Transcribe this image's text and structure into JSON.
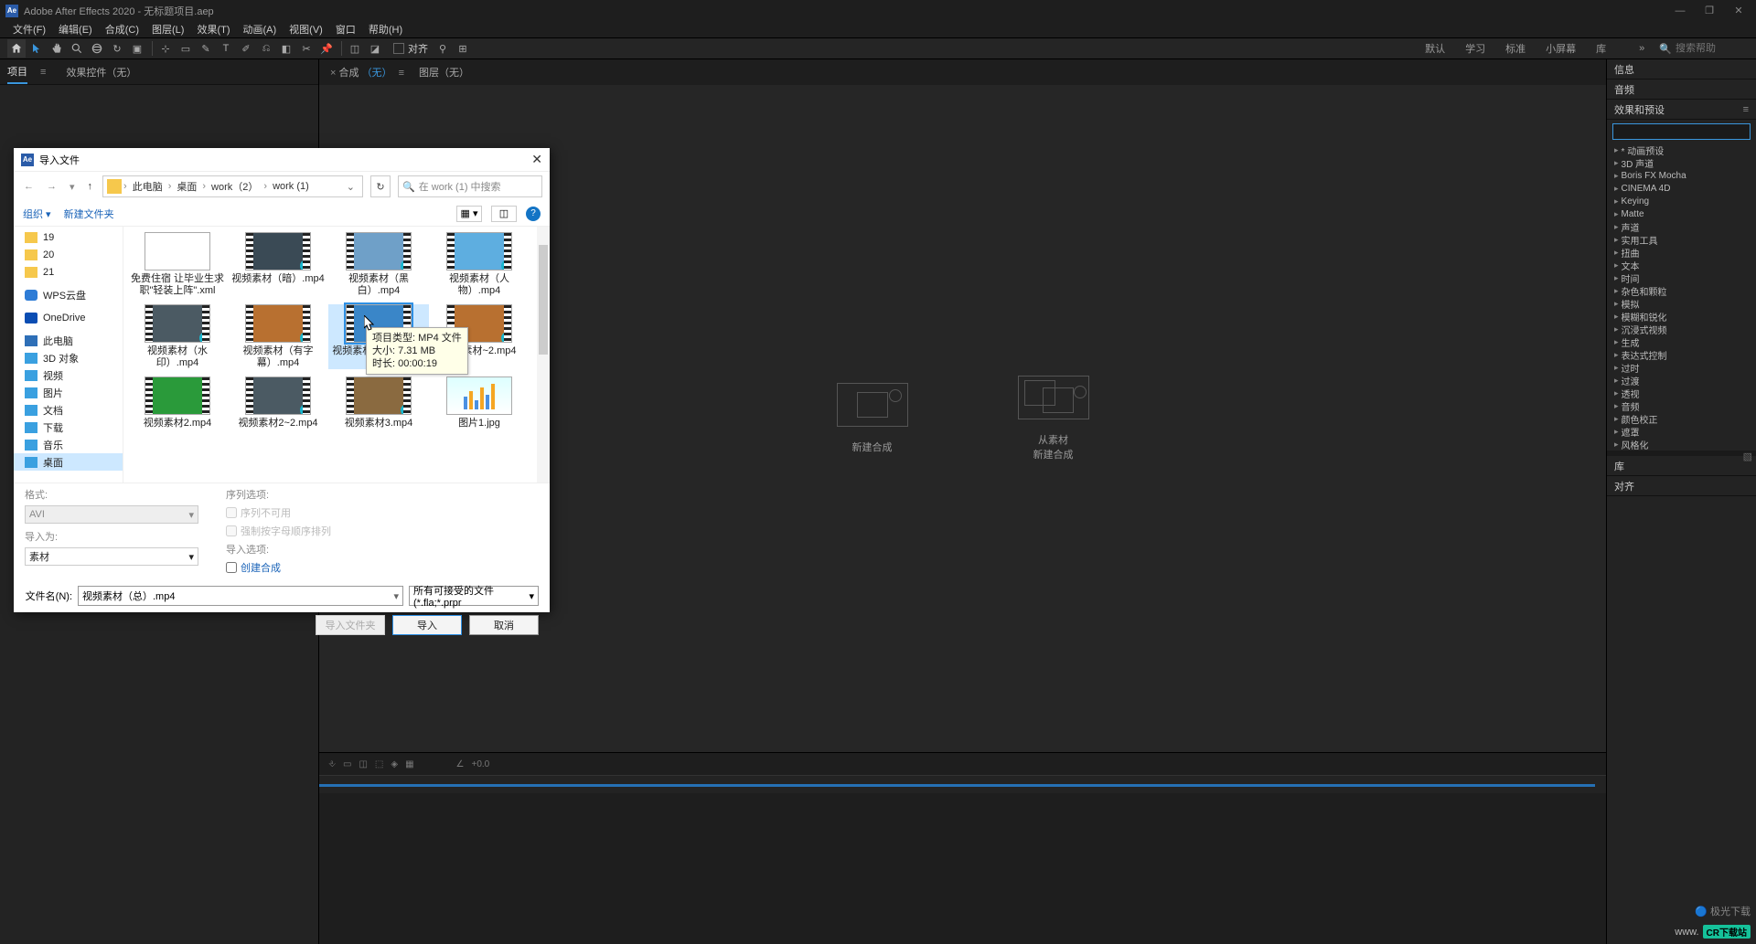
{
  "title": "Adobe After Effects 2020 - 无标题项目.aep",
  "menu": [
    "文件(F)",
    "编辑(E)",
    "合成(C)",
    "图层(L)",
    "效果(T)",
    "动画(A)",
    "视图(V)",
    "窗口",
    "帮助(H)"
  ],
  "toolbar": {
    "snap_label": "对齐"
  },
  "workspaces": [
    "默认",
    "学习",
    "标准",
    "小屏幕",
    "库"
  ],
  "search_help_placeholder": "搜索帮助",
  "left_panel": {
    "project": "项目",
    "menu_glyph": "≡",
    "effect_controls": "效果控件（无）"
  },
  "center": {
    "comp_tab_prefix": "合成",
    "comp_tab_accent": "（无）",
    "layer_tab": "图层（无）",
    "x_glyph": "×",
    "new_comp": "新建合成",
    "from_footage_l1": "从素材",
    "from_footage_l2": "新建合成",
    "timeline": {
      "angle": "∠",
      "time": "+0.0"
    }
  },
  "right": {
    "info": "信息",
    "audio": "音频",
    "effects_presets": "效果和预设",
    "search_placeholder": "",
    "effects": [
      "* 动画预设",
      "3D 声道",
      "Boris FX Mocha",
      "CINEMA 4D",
      "Keying",
      "Matte",
      "声道",
      "实用工具",
      "扭曲",
      "文本",
      "时间",
      "杂色和颗粒",
      "模拟",
      "模糊和锐化",
      "沉浸式视频",
      "生成",
      "表达式控制",
      "过时",
      "过渡",
      "透视",
      "音频",
      "颜色校正",
      "遮罩",
      "风格化"
    ],
    "library": "库",
    "align": "对齐"
  },
  "dialog": {
    "title": "导入文件",
    "crumbs": [
      "此电脑",
      "桌面",
      "work（2）",
      "work (1)"
    ],
    "search_placeholder": "在 work (1) 中搜索",
    "organize": "组织",
    "new_folder": "新建文件夹",
    "tree": [
      {
        "label": "19",
        "icon": "folder"
      },
      {
        "label": "20",
        "icon": "folder"
      },
      {
        "label": "21",
        "icon": "folder"
      },
      {
        "label": "WPS云盘",
        "icon": "cloud"
      },
      {
        "label": "OneDrive",
        "icon": "onedrive"
      },
      {
        "label": "此电脑",
        "icon": "pc"
      },
      {
        "label": "3D 对象",
        "icon": "3d"
      },
      {
        "label": "视频",
        "icon": "video"
      },
      {
        "label": "图片",
        "icon": "pic"
      },
      {
        "label": "文档",
        "icon": "doc"
      },
      {
        "label": "下载",
        "icon": "dl"
      },
      {
        "label": "音乐",
        "icon": "music"
      },
      {
        "label": "桌面",
        "icon": "desk",
        "selected": true
      }
    ],
    "files": [
      {
        "label": "免费住宿 让毕业生求职\"轻装上阵\".xml",
        "type": "xml"
      },
      {
        "label": "视频素材（暗）.mp4",
        "type": "mp4"
      },
      {
        "label": "视频素材（黑白）.mp4",
        "type": "mp4"
      },
      {
        "label": "视频素材（人物）.mp4",
        "type": "mp4"
      },
      {
        "label": "视频素材（水印）.mp4",
        "type": "mp4"
      },
      {
        "label": "视频素材（有字幕）.mp4",
        "type": "mp4"
      },
      {
        "label": "视频素材（总）.mp4",
        "type": "mp4",
        "selected": true
      },
      {
        "label": "视频素材~2.mp4",
        "type": "mp4"
      },
      {
        "label": "视频素材2.mp4",
        "type": "mp4"
      },
      {
        "label": "视频素材2~2.mp4",
        "type": "mp4"
      },
      {
        "label": "视频素材3.mp4",
        "type": "mp4"
      },
      {
        "label": "图片1.jpg",
        "type": "img"
      }
    ],
    "tooltip": {
      "l1": "项目类型: MP4 文件",
      "l2": "大小: 7.31 MB",
      "l3": "时长: 00:00:19"
    },
    "format_label": "格式:",
    "format_value": "AVI",
    "import_as_label": "导入为:",
    "import_as_value": "素材",
    "seq_opts_label": "序列选项:",
    "seq_na": "序列不可用",
    "force_alpha": "强制按字母顺序排列",
    "import_opts_label": "导入选项:",
    "create_comp": "创建合成",
    "filename_label": "文件名(N):",
    "filename_value": "视频素材（总）.mp4",
    "filter_value": "所有可接受的文件 (*.fla;*.prpr",
    "btn_folder": "导入文件夹",
    "btn_import": "导入",
    "btn_cancel": "取消"
  },
  "watermark": {
    "site": "极光下载",
    "badge": "CR下载站",
    "url": "www."
  }
}
